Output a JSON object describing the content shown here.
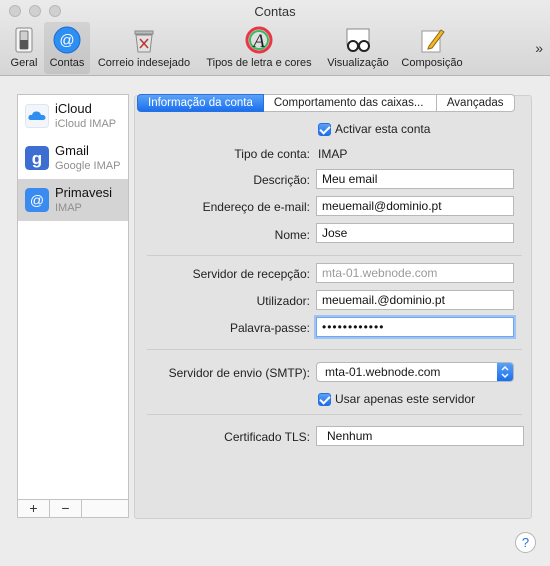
{
  "window": {
    "title": "Contas"
  },
  "toolbar": {
    "items": [
      {
        "label": "Geral",
        "icon": "switch-icon"
      },
      {
        "label": "Contas",
        "icon": "at-sign-icon"
      },
      {
        "label": "Correio indesejado",
        "icon": "junk-trash-icon"
      },
      {
        "label": "Tipos de letra e cores",
        "icon": "font-colors-icon"
      },
      {
        "label": "Visualização",
        "icon": "glasses-icon"
      },
      {
        "label": "Composição",
        "icon": "compose-pencil-icon"
      }
    ],
    "more": "»",
    "accent": "#1a6ff0"
  },
  "accounts": [
    {
      "name": "iCloud",
      "type": "iCloud IMAP",
      "icon": "cloud-icon"
    },
    {
      "name": "Gmail",
      "type": "Google IMAP",
      "icon": "google-icon"
    },
    {
      "name": "Primavesi",
      "type": "IMAP",
      "icon": "at-sign-icon"
    }
  ],
  "sidebar_buttons": {
    "add": "+",
    "remove": "−"
  },
  "tabs": [
    {
      "label": "Informação da conta"
    },
    {
      "label": "Comportamento das caixas..."
    },
    {
      "label": "Avançadas"
    }
  ],
  "form": {
    "enable_label": "Activar esta conta",
    "account_type_label": "Tipo de conta:",
    "account_type_value": "IMAP",
    "description_label": "Descrição:",
    "description_value": "Meu email",
    "email_label": "Endereço de e-mail:",
    "email_value": "meuemail@dominio.pt",
    "name_label": "Nome:",
    "name_value": "Jose",
    "incoming_label": "Servidor de recepção:",
    "incoming_value": "mta-01.webnode.com",
    "user_label": "Utilizador:",
    "user_value": "meuemail.@dominio.pt",
    "password_label": "Palavra-passe:",
    "password_value": "••••••••••••",
    "smtp_label": "Servidor de envio (SMTP):",
    "smtp_value": "mta-01.webnode.com",
    "only_server_label": "Usar apenas este servidor",
    "tls_label": "Certificado TLS:",
    "tls_value": "Nenhum"
  },
  "help": "?"
}
